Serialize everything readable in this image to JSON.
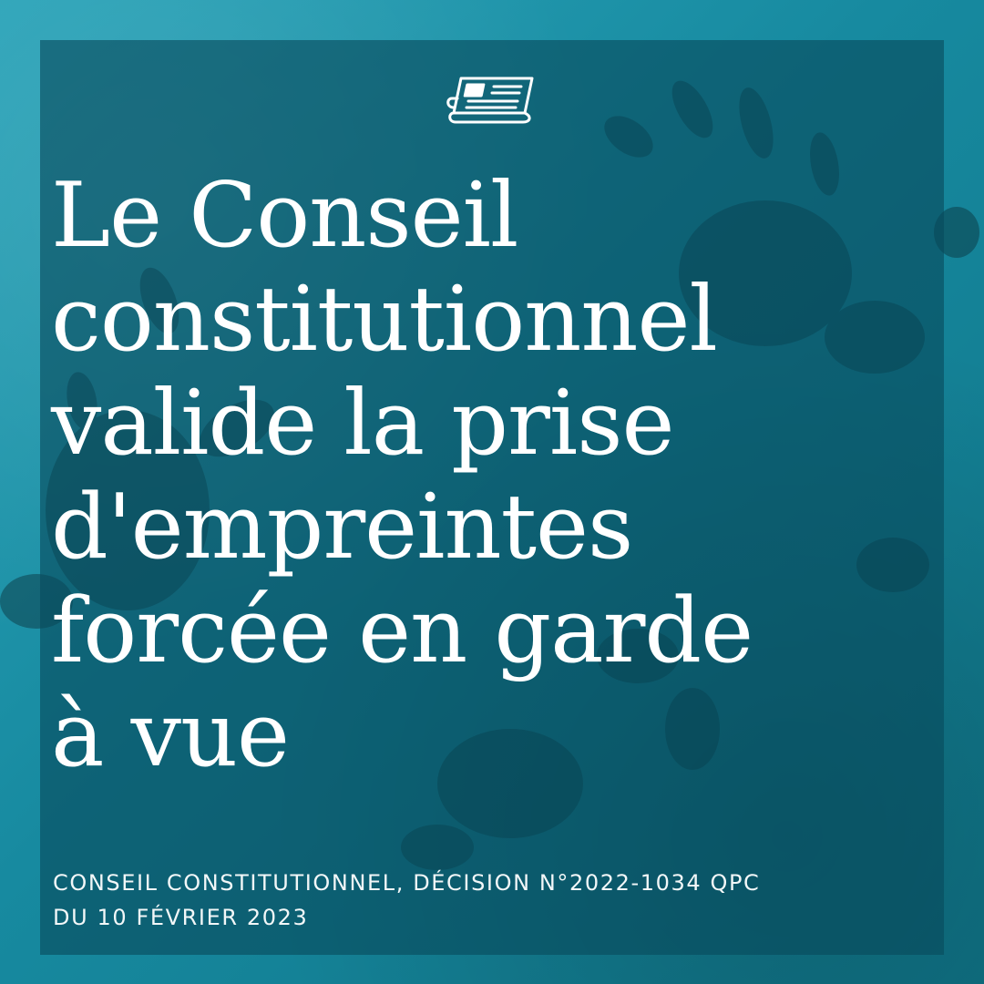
{
  "headline": {
    "lines": [
      "Le Conseil",
      "constitutionnel",
      "valide la prise",
      "d'empreintes",
      "forcée en garde",
      "à vue"
    ]
  },
  "source": {
    "lines": [
      "CONSEIL CONSTITUTIONNEL, DÉCISION N°2022-1034 QPC",
      "DU 10 FÉVRIER 2023"
    ]
  },
  "icon": "newspaper-icon",
  "colors": {
    "background": "#1a8aa0",
    "panel": "#0d5a6e",
    "text": "#ffffff"
  }
}
